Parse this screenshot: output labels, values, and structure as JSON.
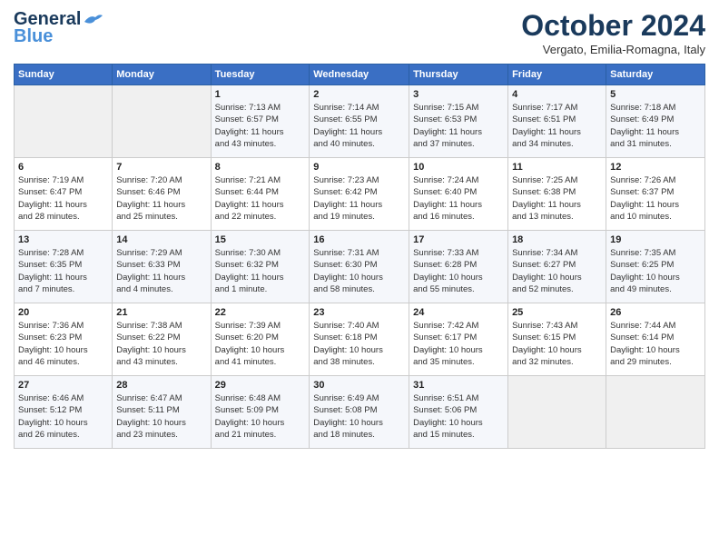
{
  "header": {
    "logo_line1": "General",
    "logo_line2": "Blue",
    "month": "October 2024",
    "location": "Vergato, Emilia-Romagna, Italy"
  },
  "days_of_week": [
    "Sunday",
    "Monday",
    "Tuesday",
    "Wednesday",
    "Thursday",
    "Friday",
    "Saturday"
  ],
  "weeks": [
    [
      {
        "num": "",
        "info": ""
      },
      {
        "num": "",
        "info": ""
      },
      {
        "num": "1",
        "info": "Sunrise: 7:13 AM\nSunset: 6:57 PM\nDaylight: 11 hours\nand 43 minutes."
      },
      {
        "num": "2",
        "info": "Sunrise: 7:14 AM\nSunset: 6:55 PM\nDaylight: 11 hours\nand 40 minutes."
      },
      {
        "num": "3",
        "info": "Sunrise: 7:15 AM\nSunset: 6:53 PM\nDaylight: 11 hours\nand 37 minutes."
      },
      {
        "num": "4",
        "info": "Sunrise: 7:17 AM\nSunset: 6:51 PM\nDaylight: 11 hours\nand 34 minutes."
      },
      {
        "num": "5",
        "info": "Sunrise: 7:18 AM\nSunset: 6:49 PM\nDaylight: 11 hours\nand 31 minutes."
      }
    ],
    [
      {
        "num": "6",
        "info": "Sunrise: 7:19 AM\nSunset: 6:47 PM\nDaylight: 11 hours\nand 28 minutes."
      },
      {
        "num": "7",
        "info": "Sunrise: 7:20 AM\nSunset: 6:46 PM\nDaylight: 11 hours\nand 25 minutes."
      },
      {
        "num": "8",
        "info": "Sunrise: 7:21 AM\nSunset: 6:44 PM\nDaylight: 11 hours\nand 22 minutes."
      },
      {
        "num": "9",
        "info": "Sunrise: 7:23 AM\nSunset: 6:42 PM\nDaylight: 11 hours\nand 19 minutes."
      },
      {
        "num": "10",
        "info": "Sunrise: 7:24 AM\nSunset: 6:40 PM\nDaylight: 11 hours\nand 16 minutes."
      },
      {
        "num": "11",
        "info": "Sunrise: 7:25 AM\nSunset: 6:38 PM\nDaylight: 11 hours\nand 13 minutes."
      },
      {
        "num": "12",
        "info": "Sunrise: 7:26 AM\nSunset: 6:37 PM\nDaylight: 11 hours\nand 10 minutes."
      }
    ],
    [
      {
        "num": "13",
        "info": "Sunrise: 7:28 AM\nSunset: 6:35 PM\nDaylight: 11 hours\nand 7 minutes."
      },
      {
        "num": "14",
        "info": "Sunrise: 7:29 AM\nSunset: 6:33 PM\nDaylight: 11 hours\nand 4 minutes."
      },
      {
        "num": "15",
        "info": "Sunrise: 7:30 AM\nSunset: 6:32 PM\nDaylight: 11 hours\nand 1 minute."
      },
      {
        "num": "16",
        "info": "Sunrise: 7:31 AM\nSunset: 6:30 PM\nDaylight: 10 hours\nand 58 minutes."
      },
      {
        "num": "17",
        "info": "Sunrise: 7:33 AM\nSunset: 6:28 PM\nDaylight: 10 hours\nand 55 minutes."
      },
      {
        "num": "18",
        "info": "Sunrise: 7:34 AM\nSunset: 6:27 PM\nDaylight: 10 hours\nand 52 minutes."
      },
      {
        "num": "19",
        "info": "Sunrise: 7:35 AM\nSunset: 6:25 PM\nDaylight: 10 hours\nand 49 minutes."
      }
    ],
    [
      {
        "num": "20",
        "info": "Sunrise: 7:36 AM\nSunset: 6:23 PM\nDaylight: 10 hours\nand 46 minutes."
      },
      {
        "num": "21",
        "info": "Sunrise: 7:38 AM\nSunset: 6:22 PM\nDaylight: 10 hours\nand 43 minutes."
      },
      {
        "num": "22",
        "info": "Sunrise: 7:39 AM\nSunset: 6:20 PM\nDaylight: 10 hours\nand 41 minutes."
      },
      {
        "num": "23",
        "info": "Sunrise: 7:40 AM\nSunset: 6:18 PM\nDaylight: 10 hours\nand 38 minutes."
      },
      {
        "num": "24",
        "info": "Sunrise: 7:42 AM\nSunset: 6:17 PM\nDaylight: 10 hours\nand 35 minutes."
      },
      {
        "num": "25",
        "info": "Sunrise: 7:43 AM\nSunset: 6:15 PM\nDaylight: 10 hours\nand 32 minutes."
      },
      {
        "num": "26",
        "info": "Sunrise: 7:44 AM\nSunset: 6:14 PM\nDaylight: 10 hours\nand 29 minutes."
      }
    ],
    [
      {
        "num": "27",
        "info": "Sunrise: 6:46 AM\nSunset: 5:12 PM\nDaylight: 10 hours\nand 26 minutes."
      },
      {
        "num": "28",
        "info": "Sunrise: 6:47 AM\nSunset: 5:11 PM\nDaylight: 10 hours\nand 23 minutes."
      },
      {
        "num": "29",
        "info": "Sunrise: 6:48 AM\nSunset: 5:09 PM\nDaylight: 10 hours\nand 21 minutes."
      },
      {
        "num": "30",
        "info": "Sunrise: 6:49 AM\nSunset: 5:08 PM\nDaylight: 10 hours\nand 18 minutes."
      },
      {
        "num": "31",
        "info": "Sunrise: 6:51 AM\nSunset: 5:06 PM\nDaylight: 10 hours\nand 15 minutes."
      },
      {
        "num": "",
        "info": ""
      },
      {
        "num": "",
        "info": ""
      }
    ]
  ]
}
